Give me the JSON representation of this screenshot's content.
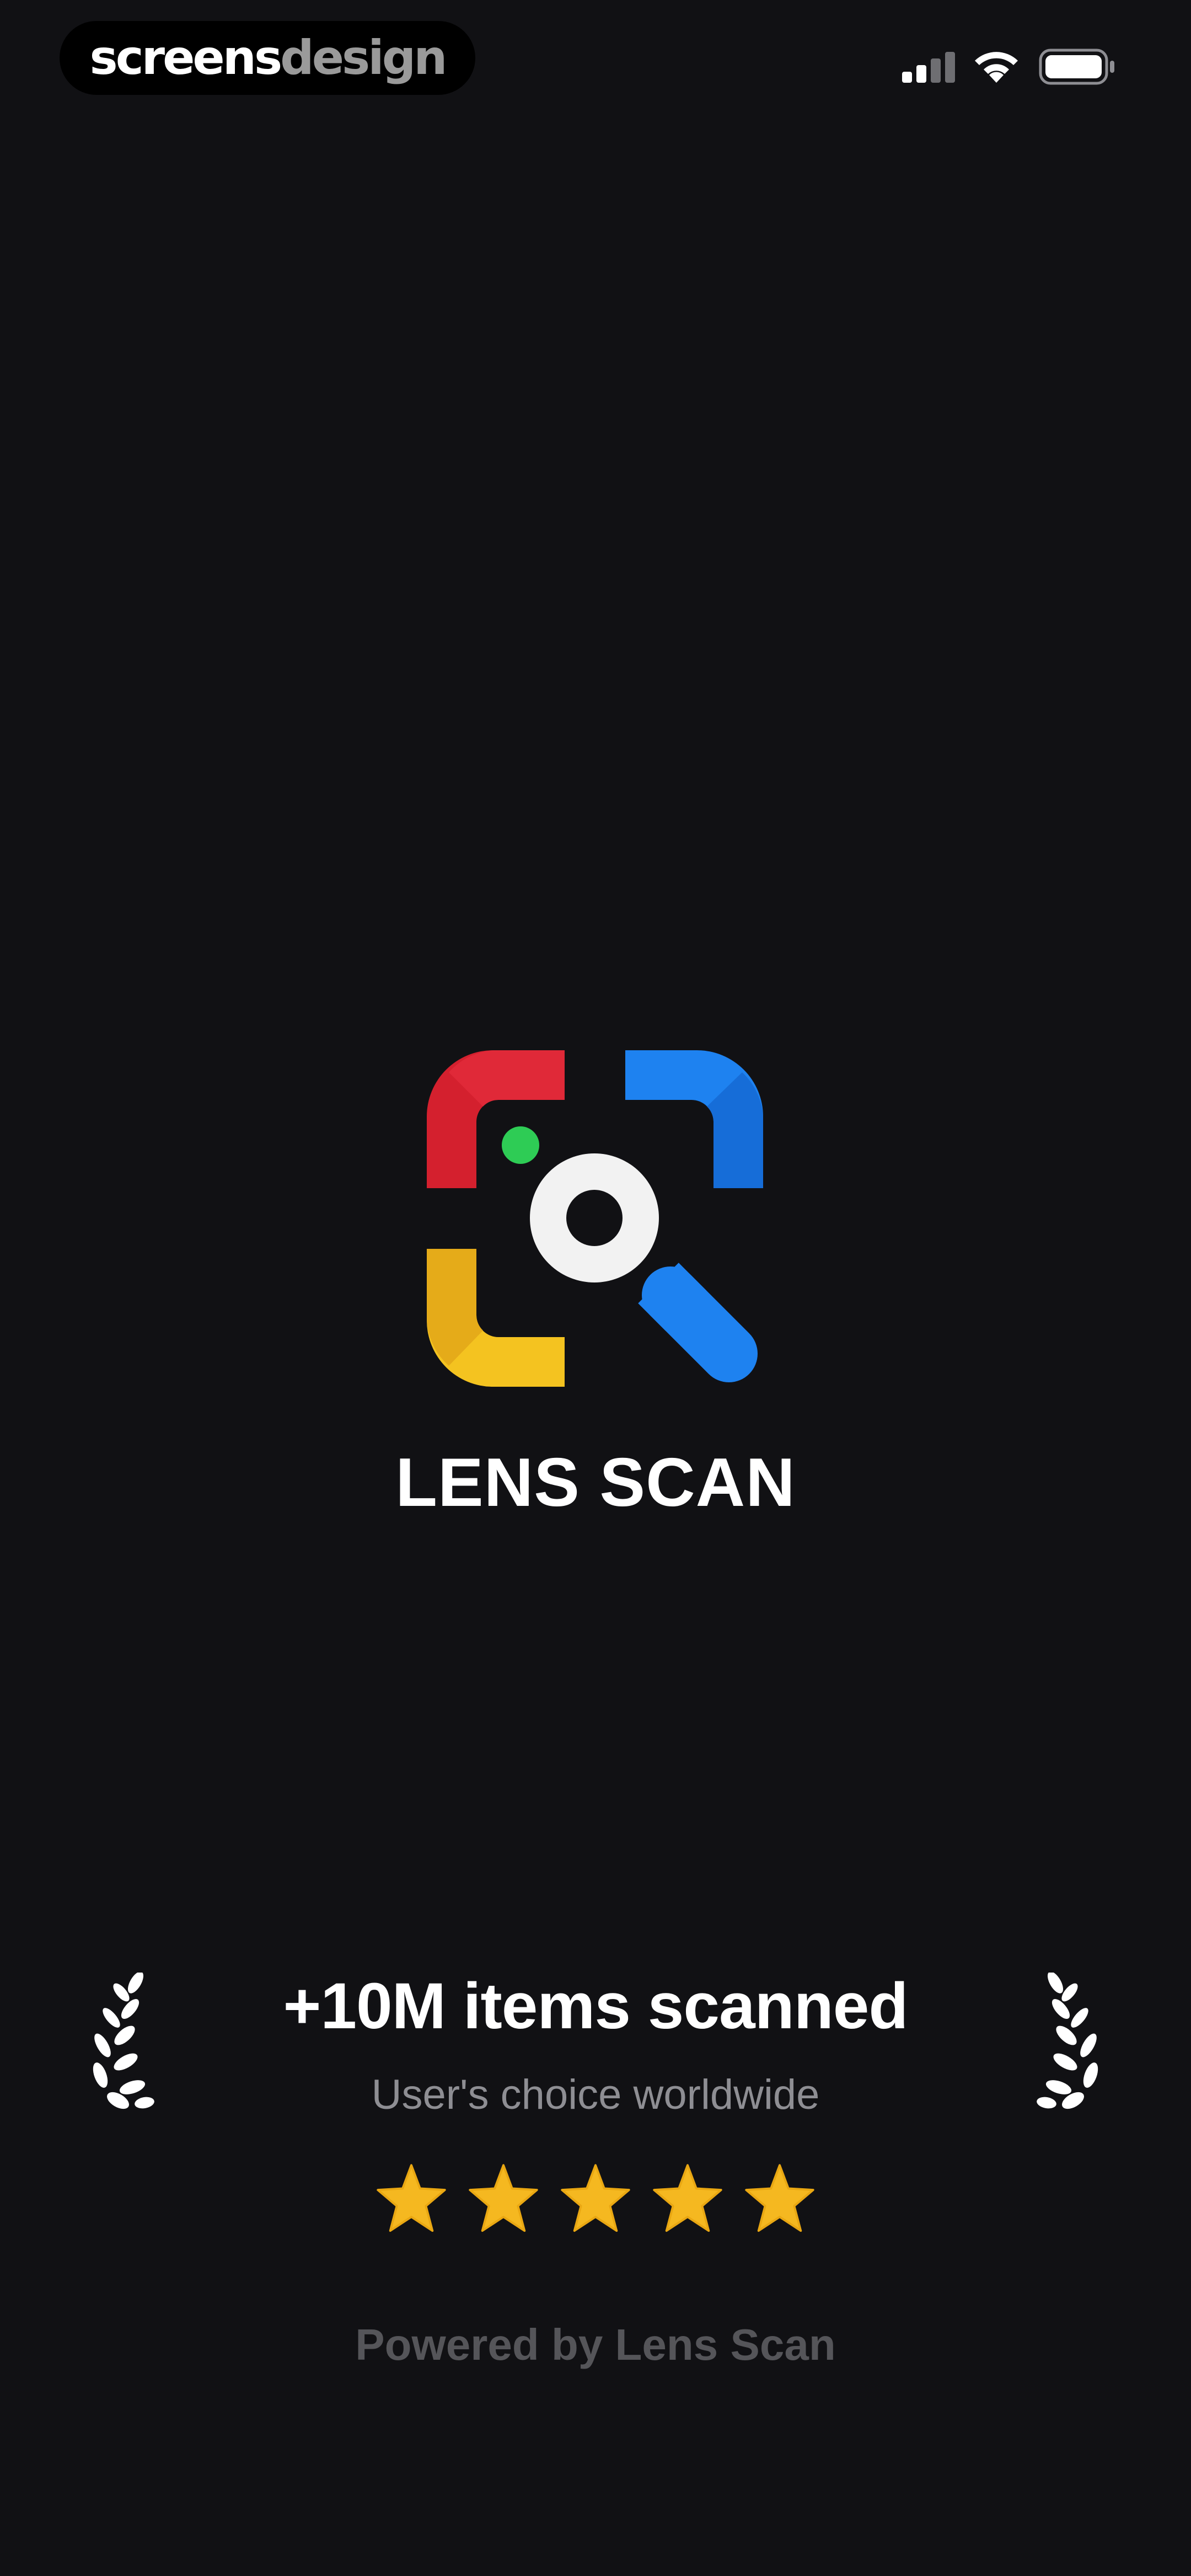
{
  "status_bar": {
    "brand_part1": "screens",
    "brand_part2": "design",
    "icons": [
      "cellular-signal-icon",
      "wifi-icon",
      "battery-icon"
    ]
  },
  "app": {
    "title": "LENS SCAN",
    "logo_icon": "lens-scan-logo-icon",
    "logo_colors": {
      "red": "#D4202E",
      "blue": "#1E82F0",
      "yellow": "#F4C320",
      "green": "#2ECC55",
      "lens": "#F2F2F2"
    }
  },
  "stats": {
    "title": "+10M items scanned",
    "subtitle": "User's choice worldwide",
    "rating_stars": 5,
    "star_icon": "star-icon",
    "laurel_icon": "laurel-icon"
  },
  "footer": {
    "text": "Powered by Lens Scan"
  },
  "colors": {
    "background": "#111114",
    "primary_text": "#FFFFFF",
    "secondary_text": "#8E8E93",
    "footer_text": "#555559",
    "star": "#F5B820"
  }
}
